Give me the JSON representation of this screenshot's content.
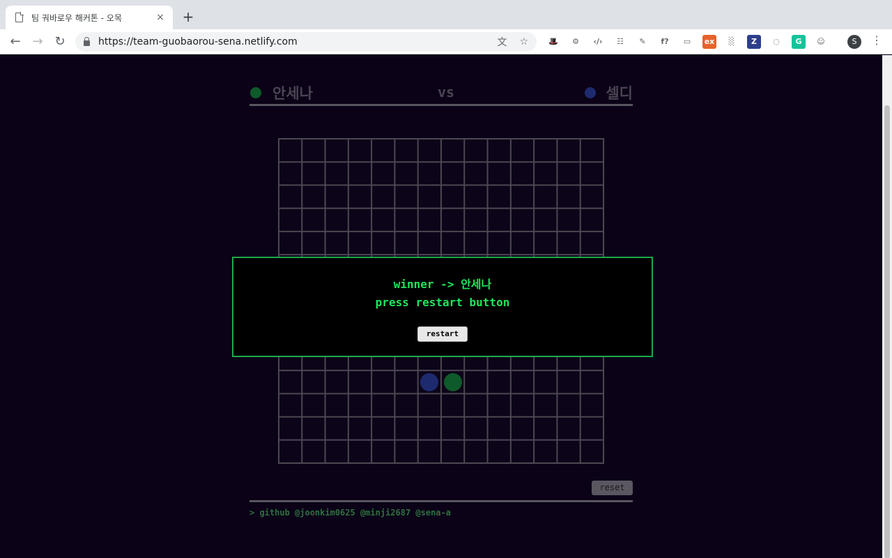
{
  "browser": {
    "tab_title": "팀 궈바로우 해커톤 - 오목",
    "tab_close": "×",
    "new_tab": "+",
    "url": "https://team-guobaorou-sena.netlify.com",
    "profile_initial": "S",
    "extensions": [
      {
        "icon": "detective-extension-icon",
        "label": "🎩",
        "color": "#ffffff"
      },
      {
        "icon": "gear-extension-icon",
        "label": "⚙",
        "color": "#ffffff"
      },
      {
        "icon": "code-extension-icon",
        "label": "‹/›",
        "color": "#ffffff"
      },
      {
        "icon": "ladder-extension-icon",
        "label": "☷",
        "color": "#ffffff"
      },
      {
        "icon": "eyedropper-extension-icon",
        "label": "✎",
        "color": "#ffffff"
      },
      {
        "icon": "font-extension-icon",
        "label": "f?",
        "color": "#ffffff"
      },
      {
        "icon": "cast-extension-icon",
        "label": "▭",
        "color": "#ffffff"
      },
      {
        "icon": "ex-extension-icon",
        "label": "ex",
        "color": "#e8622c"
      },
      {
        "icon": "grid-extension-icon",
        "label": "░",
        "color": "#ffffff"
      },
      {
        "icon": "z-extension-icon",
        "label": "Z",
        "color": "#2d3e8c"
      },
      {
        "icon": "spinner-extension-icon",
        "label": "◌",
        "color": "#ffffff"
      },
      {
        "icon": "grammarly-extension-icon",
        "label": "G",
        "color": "#15c39a"
      },
      {
        "icon": "discord-extension-icon",
        "label": "☺",
        "color": "#ffffff"
      }
    ]
  },
  "game": {
    "player1": {
      "name": "안세나",
      "color": "#0f5a2a"
    },
    "player2": {
      "name": "셀디",
      "color": "#1e2a6e"
    },
    "vs_label": "vs",
    "board": {
      "cells": 14,
      "line_color": "#4c4752",
      "background": "#0c0418"
    },
    "stones": [
      {
        "col": 6,
        "row": 10,
        "color": "#1e2a6e",
        "player": "셀디"
      },
      {
        "col": 7,
        "row": 10,
        "color": "#0f5a2a",
        "player": "안세나"
      }
    ],
    "modal": {
      "line1": "winner -> 안세나",
      "line2": "press restart button",
      "restart_label": "restart"
    },
    "reset_label": "reset",
    "footer": "> github @joonkim0625 @minji2687 @sena-a"
  }
}
